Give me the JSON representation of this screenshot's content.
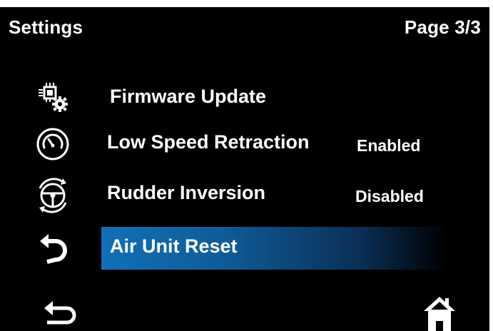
{
  "header": {
    "title": "Settings",
    "page": "Page 3/3"
  },
  "menu": {
    "items": [
      {
        "label": "Firmware Update",
        "value": "",
        "icon": "firmware-chip-gear-icon"
      },
      {
        "label": "Low Speed Retraction",
        "value": "Enabled",
        "icon": "speedometer-icon"
      },
      {
        "label": "Rudder Inversion",
        "value": "Disabled",
        "icon": "steering-wheel-icon"
      },
      {
        "label": "Air Unit Reset",
        "value": "",
        "icon": "reset-arrow-icon",
        "selected": true
      }
    ]
  },
  "footer": {
    "back_icon": "back-arrow-icon",
    "home_icon": "home-icon"
  },
  "colors": {
    "background": "#000000",
    "text": "#ffffff",
    "highlight": "#1170b8"
  }
}
